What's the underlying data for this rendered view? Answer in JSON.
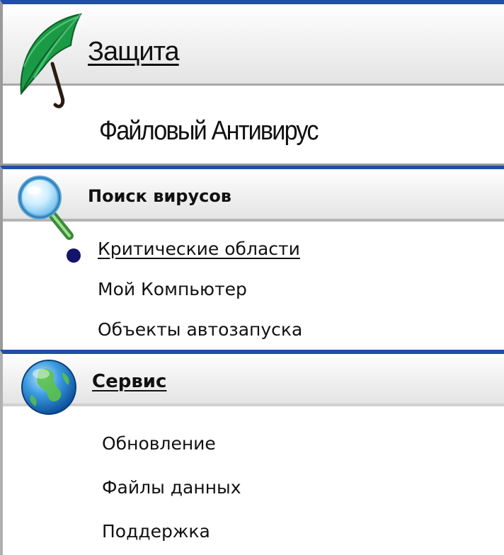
{
  "protection": {
    "heading": "Защита",
    "icon": "umbrella-icon",
    "items": [
      {
        "label": "Файловый Антивирус"
      }
    ]
  },
  "scan": {
    "heading": "Поиск вирусов",
    "icon": "magnifier-icon",
    "items": [
      {
        "label": "Критические области",
        "selected": true
      },
      {
        "label": "Мой Компьютер"
      },
      {
        "label": "Объекты автозапуска"
      }
    ]
  },
  "service": {
    "heading": "Сервис",
    "icon": "globe-icon",
    "items": [
      {
        "label": "Обновление"
      },
      {
        "label": "Файлы данных"
      },
      {
        "label": "Поддержка"
      }
    ]
  },
  "colors": {
    "accent_border": "#1f4fa8",
    "bullet": "#14146a",
    "umbrella_green": "#1a9a45"
  }
}
